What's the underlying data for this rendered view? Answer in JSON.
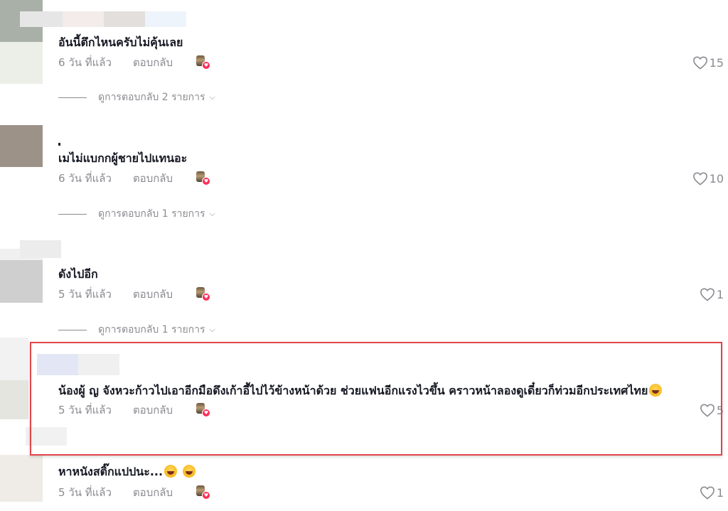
{
  "comments": [
    {
      "text": "อันนี้ตึกไหนครับไม่คุ้นเลย",
      "time": "6 วัน ที่แล้ว",
      "reply_label": "ตอบกลับ",
      "likes": "15",
      "view_replies": "ดูการตอบกลับ 2 รายการ"
    },
    {
      "text": "เมไม่แบกกผู้ชายไปแทนอะ",
      "time": "6 วัน ที่แล้ว",
      "reply_label": "ตอบกลับ",
      "likes": "10",
      "view_replies": "ดูการตอบกลับ 1 รายการ"
    },
    {
      "text": "ดังไปอีก",
      "time": "5 วัน ที่แล้ว",
      "reply_label": "ตอบกลับ",
      "likes": "1",
      "view_replies": "ดูการตอบกลับ 1 รายการ"
    },
    {
      "text": "น้องผู้ ญ จังหวะก้าวไปเอาอีกมือดึงเก้าอี้ไปไว้ข้างหน้าด้วย ช่วยแฟนอีกแรงไวขึ้น คราวหน้าลองดูเดี๋ยวก็ท่วมอีกประเทศไทย",
      "time": "5 วัน ที่แล้ว",
      "reply_label": "ตอบกลับ",
      "likes": "5"
    },
    {
      "text": "หาหนังสติ๊กแปปนะ...",
      "time": "5 วัน ที่แล้ว",
      "reply_label": "ตอบกลับ",
      "likes": "1"
    }
  ],
  "icons": {
    "like": "heart-outline-icon",
    "creator_like": "creator-liked-badge-icon",
    "expand": "chevron-down-icon",
    "emoji": "laughing-emoji-icon"
  },
  "colors": {
    "text": "#161823",
    "meta": "#8a8b91",
    "highlight_border": "#e0464b",
    "creator_heart": "#fe2c55"
  }
}
